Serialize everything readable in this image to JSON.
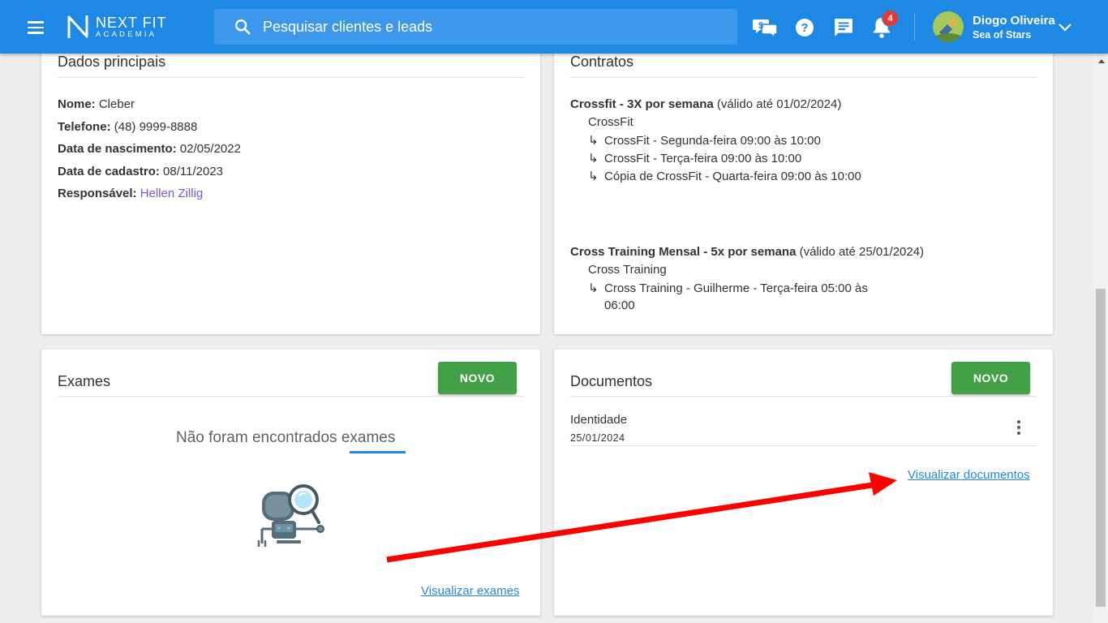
{
  "topbar": {
    "logo_line1": "NEXT FIT",
    "logo_line2": "ACADEMIA",
    "search_placeholder": "Pesquisar clientes e leads",
    "notifications_count": "4",
    "user_name": "Diogo Oliveira",
    "user_subtitle": "Sea of Stars",
    "icons": [
      "menu-icon",
      "search-icon",
      "financial-chat-icon",
      "help-icon",
      "message-icon",
      "bell-icon",
      "chevron-down-icon"
    ]
  },
  "dados": {
    "title": "Dados principais",
    "fields": [
      {
        "label": "Nome:",
        "value": "Cleber"
      },
      {
        "label": "Telefone:",
        "value": "(48) 9999-8888"
      },
      {
        "label": "Data de nascimento:",
        "value": "02/05/2022"
      },
      {
        "label": "Data de cadastro:",
        "value": "08/11/2023"
      },
      {
        "label": "Responsável:",
        "value": "Hellen Zillig"
      }
    ]
  },
  "contratos": {
    "title": "Contratos",
    "items": [
      {
        "name": "Crossfit - 3X por semana",
        "validity": "(válido até 01/02/2024)",
        "modality": "CrossFit",
        "classes": [
          "CrossFit - Segunda-feira 09:00 às 10:00",
          "CrossFit - Terça-feira 09:00 às 10:00",
          "Cópia de CrossFit - Quarta-feira 09:00 às 10:00"
        ]
      },
      {
        "name": "Cross Training Mensal - 5x por semana",
        "validity": "(válido até 25/01/2024)",
        "modality": "Cross Training",
        "classes": [
          "Cross Training - Guilherme - Terça-feira 05:00 às",
          "06:00"
        ]
      }
    ]
  },
  "exames": {
    "title": "Exames",
    "new_label": "NOVO",
    "empty_text": "Não foram encontrados exames",
    "link_label": "Visualizar exames"
  },
  "documentos": {
    "title": "Documentos",
    "new_label": "NOVO",
    "items": [
      {
        "name": "Identidade",
        "date": "25/01/2024"
      }
    ],
    "link_label": "Visualizar documentos"
  },
  "colors": {
    "topbar": "#1e88e5",
    "button_green": "#43a047",
    "link_blue": "#1e88e5",
    "responsavel_purple": "#7e57c2",
    "annotation_red": "#ff0000"
  }
}
